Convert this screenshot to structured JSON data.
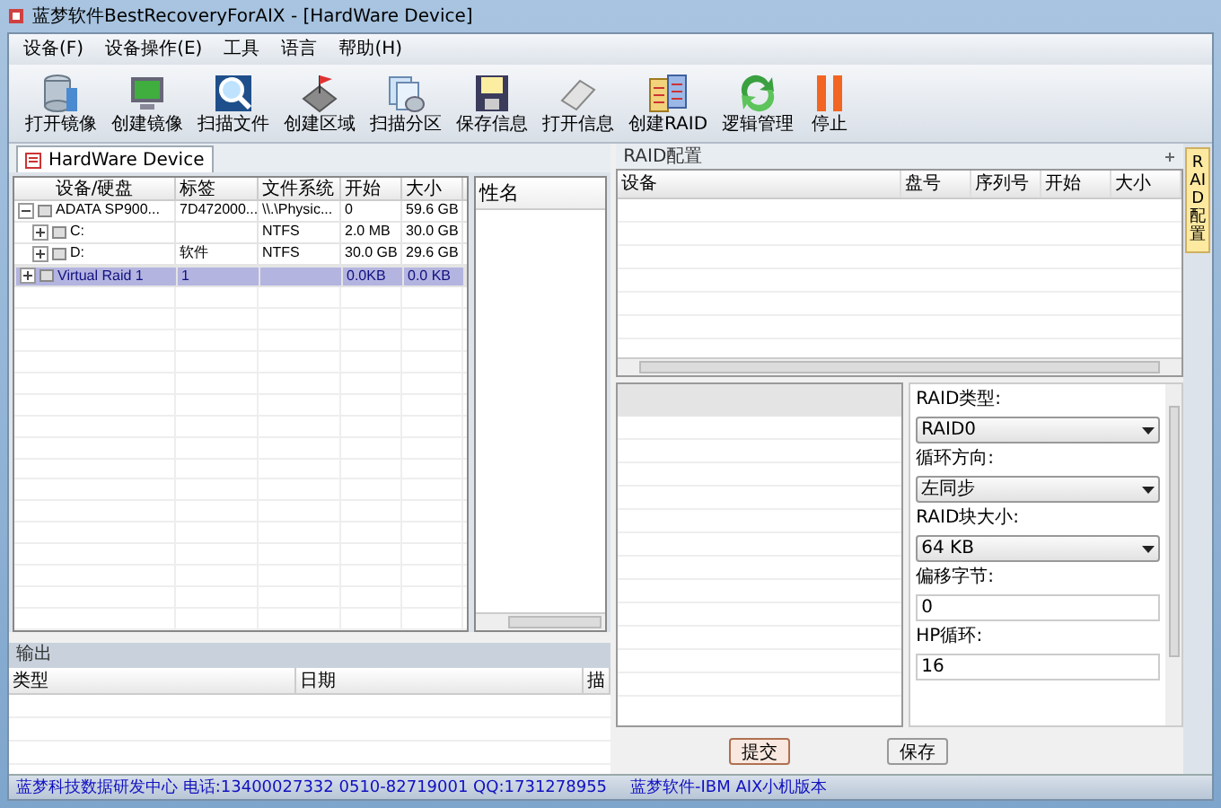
{
  "window": {
    "title": "蓝梦软件BestRecoveryForAIX - [HardWare Device]"
  },
  "menu": [
    "设备(F)",
    "设备操作(E)",
    "工具",
    "语言",
    "帮助(H)"
  ],
  "toolbar": [
    {
      "label": "打开镜像",
      "kind": "disk"
    },
    {
      "label": "创建镜像",
      "kind": "monitor"
    },
    {
      "label": "扫描文件",
      "kind": "magnifier"
    },
    {
      "label": "创建区域",
      "kind": "flag"
    },
    {
      "label": "扫描分区",
      "kind": "pages"
    },
    {
      "label": "保存信息",
      "kind": "floppy"
    },
    {
      "label": "打开信息",
      "kind": "eraser"
    },
    {
      "label": "创建RAID",
      "kind": "raid"
    },
    {
      "label": "逻辑管理",
      "kind": "recycle"
    },
    {
      "label": "停止",
      "kind": "pause"
    }
  ],
  "document_tab": {
    "label": "HardWare Device",
    "selected": true
  },
  "device_tree": {
    "columns": [
      "设备/硬盘",
      "标签",
      "文件系统",
      "开始",
      "大小"
    ],
    "rows": [
      {
        "cells": [
          "ADATA SP900...",
          "7D472000...",
          "\\\\.\\Physic...",
          "0",
          "59.6 GB"
        ],
        "expanded": true,
        "selected": false,
        "children": [
          {
            "cells": [
              "C:",
              "",
              "NTFS",
              "2.0 MB",
              "30.0 GB"
            ],
            "expanded": false,
            "selected": false
          },
          {
            "cells": [
              "D:",
              "软件",
              "NTFS",
              "30.0 GB",
              "29.6 GB"
            ],
            "expanded": false,
            "selected": false
          }
        ]
      },
      {
        "cells": [
          "Virtual Raid 1",
          "1",
          "",
          "0.0KB",
          "0.0 KB"
        ],
        "expanded": false,
        "selected": true
      }
    ]
  },
  "name_list": {
    "column": "性名"
  },
  "output": {
    "title": "输出",
    "columns": [
      "类型",
      "日期",
      "描"
    ]
  },
  "status_left": "蓝梦科技数据研发中心 电话:13400027332 0510-82719001 QQ:1731278955",
  "raid_panel": {
    "title": "RAID配置",
    "columns": [
      "设备",
      "盘号",
      "序列号",
      "开始",
      "大小"
    ]
  },
  "raid_form": [
    {
      "label": "RAID类型:",
      "kind": "select",
      "value": "RAID0"
    },
    {
      "label": "循环方向:",
      "kind": "select",
      "value": "左同步"
    },
    {
      "label": "RAID块大小:",
      "kind": "select",
      "value": "64 KB"
    },
    {
      "label": "偏移字节:",
      "kind": "input",
      "value": "0"
    },
    {
      "label": "HP循环:",
      "kind": "input",
      "value": "16"
    }
  ],
  "buttons": [
    {
      "label": "提交",
      "selected": true
    },
    {
      "label": "保存",
      "selected": false
    }
  ],
  "status_right": "蓝梦软件-IBM AIX小机版本",
  "side_tab": {
    "label": "RAID配置"
  }
}
